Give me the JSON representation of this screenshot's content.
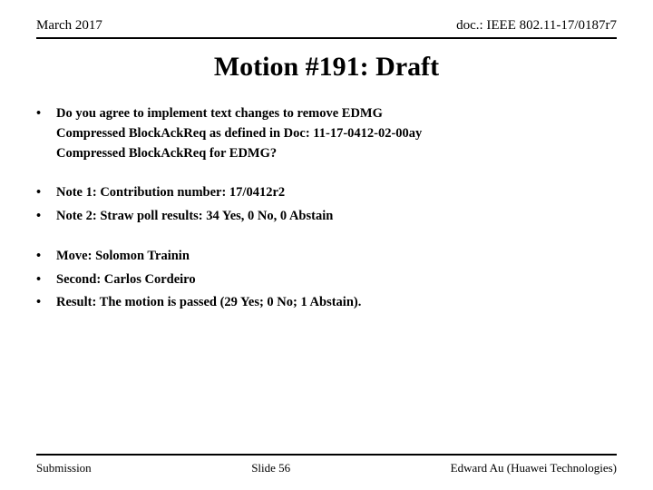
{
  "header": {
    "left": "March 2017",
    "right": "doc.: IEEE 802.11-17/0187r7"
  },
  "title": "Motion #191:  Draft",
  "bullets": [
    {
      "id": "bullet1",
      "lines": [
        "Do you agree to implement text changes to remove EDMG",
        "Compressed BlockAckReq as defined in Doc: 11-17-0412-02-00ay",
        "Compressed BlockAckReq for EDMG?"
      ]
    }
  ],
  "notes": [
    {
      "id": "note1",
      "text": "Note 1:  Contribution number:  17/0412r2"
    },
    {
      "id": "note2",
      "text": "Note 2:  Straw poll results:  34 Yes, 0 No, 0 Abstain"
    }
  ],
  "results": [
    {
      "id": "move",
      "text": "Move:  Solomon Trainin"
    },
    {
      "id": "second",
      "text": "Second:  Carlos Cordeiro"
    },
    {
      "id": "result",
      "text": "Result:  The motion is passed (29 Yes; 0 No; 1 Abstain)."
    }
  ],
  "footer": {
    "left": "Submission",
    "center": "Slide 56",
    "right": "Edward Au (Huawei Technologies)"
  }
}
